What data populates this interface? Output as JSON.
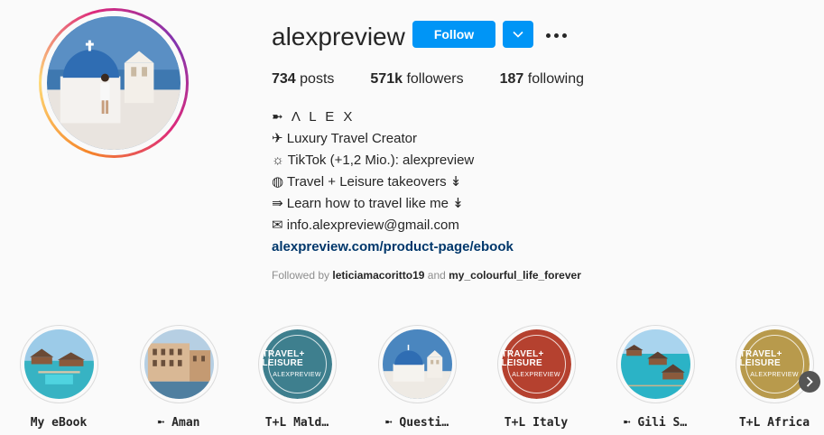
{
  "profile": {
    "username": "alexpreview",
    "follow_label": "Follow",
    "stats": {
      "posts_count": "734",
      "posts_label": "posts",
      "followers_count": "571k",
      "followers_label": "followers",
      "following_count": "187",
      "following_label": "following"
    },
    "bio": {
      "name": "➼ Λ L E X",
      "line1": "✈ Luxury Travel Creator",
      "line2": "☼ TikTok (+1,2 Mio.): alexpreview",
      "line3": "◍ Travel + Leisure takeovers ↡",
      "line4": "⇛ Learn how to travel like me ↡",
      "line5": "✉ info.alexpreview@gmail.com",
      "link": "alexpreview.com/product-page/ebook"
    },
    "followed_by": {
      "prefix": "Followed by",
      "user1": "leticiamacoritto19",
      "joiner": "and",
      "user2": "my_colourful_life_forever"
    }
  },
  "highlights": [
    {
      "label": "My eBook",
      "kind": "resort"
    },
    {
      "label": "➼ Aman",
      "kind": "venice"
    },
    {
      "label": "T+L Mald…",
      "kind": "badge",
      "badge_title": "TRAVEL+ LEISURE",
      "badge_sub": "ALEXPREVIEW",
      "color": "#3e7f8e"
    },
    {
      "label": "➼ Questi…",
      "kind": "santorini"
    },
    {
      "label": "T+L Italy",
      "kind": "badge",
      "badge_title": "TRAVEL+ LEISURE",
      "badge_sub": "ALEXPREVIEW",
      "color": "#b5412f"
    },
    {
      "label": "➼ Gili S…",
      "kind": "resort2"
    },
    {
      "label": "T+L Africa",
      "kind": "badge",
      "badge_title": "TRAVEL+ LEISURE",
      "badge_sub": "ALEXPREVIEW",
      "color": "#b89a4c"
    }
  ],
  "colors": {
    "accent": "#0095f6",
    "link": "#00376b",
    "muted": "#8e8e8e"
  },
  "icons": {
    "dropdown": "chevron-down-icon",
    "more": "more-horizontal-icon",
    "next": "chevron-right-icon"
  }
}
